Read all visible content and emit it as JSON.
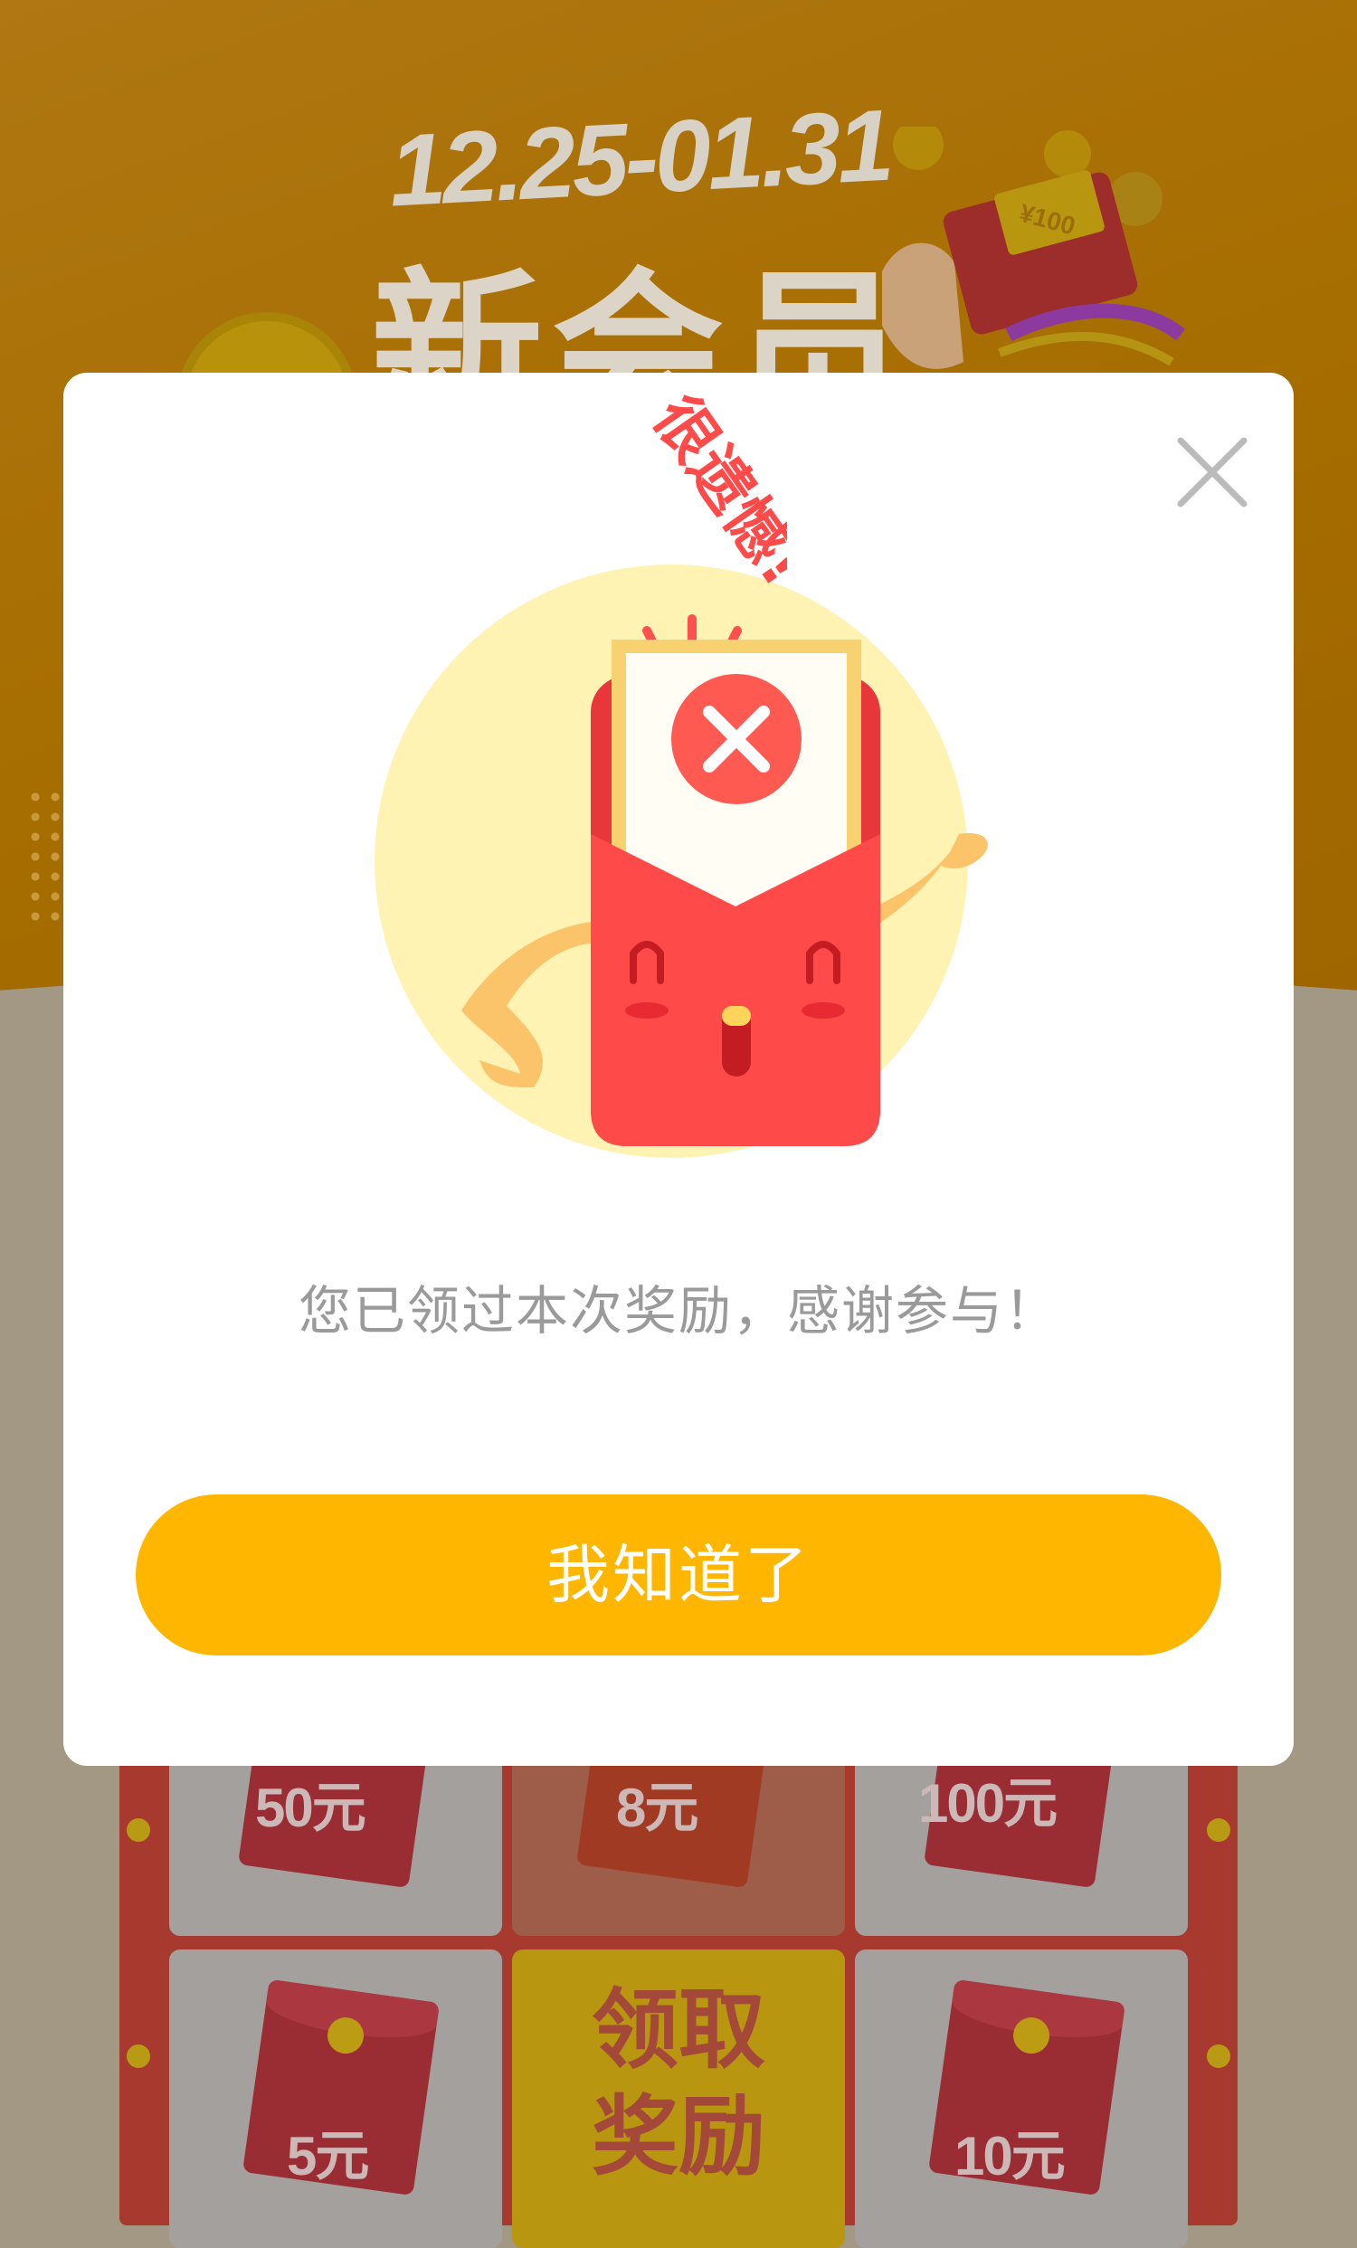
{
  "banner": {
    "date_range": "12.25-01.31",
    "title": "新会员",
    "envelope_amount": "¥100"
  },
  "rewards": {
    "row1": [
      "50元",
      "8元",
      "100元"
    ],
    "row2_left": "5元",
    "row2_right": "10元",
    "claim_line1": "领取",
    "claim_line2": "奖励"
  },
  "modal": {
    "exclamation": "很遗憾!",
    "message": "您已领过本次奖励，感谢参与！",
    "confirm_label": "我知道了"
  },
  "colors": {
    "primary_button": "#ffb600",
    "envelope_red": "#ff4a4a",
    "exclamation_red": "#ff4a4a",
    "message_gray": "#9a9a9a",
    "circle_yellow": "#fff3b4"
  }
}
